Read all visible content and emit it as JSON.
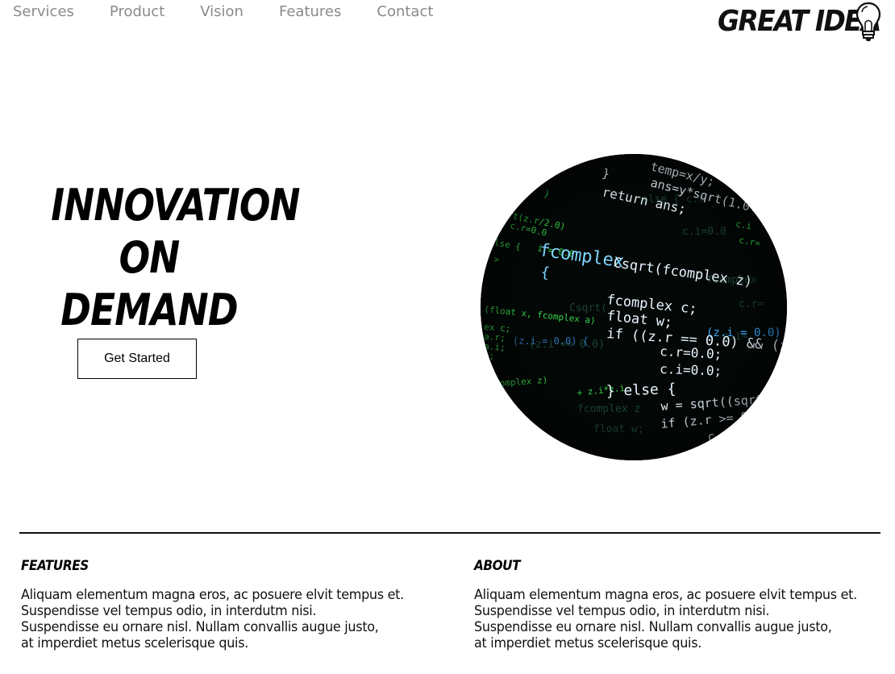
{
  "nav": {
    "links": [
      "Services",
      "Product",
      "Vision",
      "Features",
      "Contact"
    ]
  },
  "logo": {
    "text": "GREAT IDEA",
    "icon": "lightbulb-icon"
  },
  "hero": {
    "headline_lines": [
      "INNOVATION",
      "ON",
      "DEMAND"
    ],
    "cta_label": "Get Started",
    "image_subject": "code-screen-image"
  },
  "features": {
    "heading": "FEATURES",
    "lines": [
      "Aliquam elementum magna eros, ac posuere elvit tempus et.",
      "Suspendisse vel tempus odio, in interdutm nisi.",
      "Suspendisse eu ornare nisl. Nullam convallis augue justo,",
      "at imperdiet metus scelerisque quis."
    ]
  },
  "about": {
    "heading": "ABOUT",
    "lines": [
      "Aliquam elementum magna eros, ac posuere elvit tempus et.",
      "Suspendisse vel tempus odio, in interdutm nisi.",
      "Suspendisse eu ornare nisl. Nullam convallis augue justo,",
      "at imperdiet metus scelerisque quis."
    ]
  },
  "colors": {
    "nav_text": "#8a8a8a",
    "text": "#000000",
    "code_bg": "#030806",
    "code_white": "#e8f4ff",
    "code_cyan": "#7fd6ff",
    "code_green": "#3ad14a"
  }
}
